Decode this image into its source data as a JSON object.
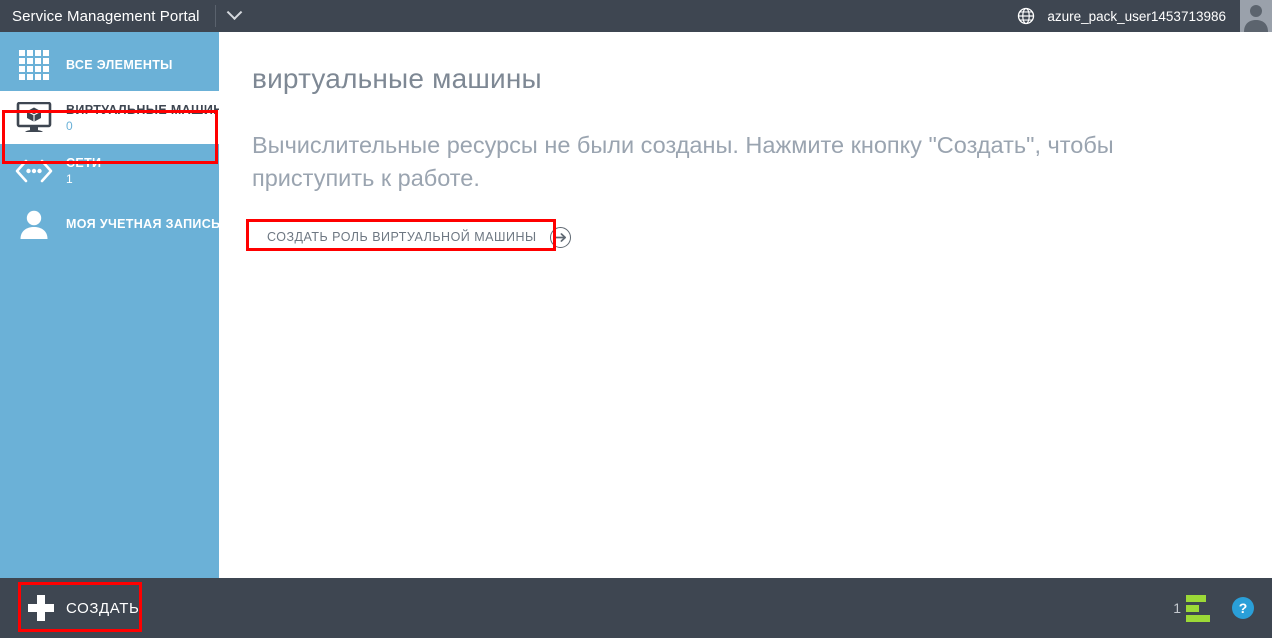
{
  "topbar": {
    "brand": "Service Management Portal",
    "chevron_icon": "chevron-down-icon",
    "globe_icon": "globe-icon",
    "user_name": "azure_pack_user1453713986",
    "avatar_icon": "user-avatar-icon"
  },
  "sidebar": {
    "items": [
      {
        "label": "ВСЕ ЭЛЕМЕНТЫ",
        "count": "",
        "icon": "grid-icon",
        "selected": false
      },
      {
        "label": "ВИРТУАЛЬНЫЕ МАШИНЫ",
        "count": "0",
        "icon": "virtual-machine-icon",
        "selected": true
      },
      {
        "label": "СЕТИ",
        "count": "1",
        "icon": "networks-icon",
        "selected": false
      },
      {
        "label": "МОЯ УЧЕТНАЯ ЗАПИСЬ",
        "count": "",
        "icon": "user-account-icon",
        "selected": false
      }
    ]
  },
  "main": {
    "page_title": "виртуальные машины",
    "empty_message": "Вычислительные ресурсы не были созданы. Нажмите кнопку \"Создать\", чтобы приступить к работе.",
    "create_link_label": "СОЗДАТЬ РОЛЬ ВИРТУАЛЬНОЙ МАШИНЫ",
    "create_link_icon": "arrow-right-circle-icon"
  },
  "bottombar": {
    "new_label": "СОЗДАТЬ",
    "new_icon": "plus-icon",
    "status_count": "1",
    "status_icon": "activity-bars-icon",
    "help_label": "?",
    "help_icon": "help-icon"
  },
  "colors": {
    "topbar": "#3e4651",
    "sidebar": "#6bb1d7",
    "accent_green": "#9cd937",
    "accent_blue": "#2a9fd8",
    "annotation": "#ff0000",
    "text_muted": "#9aa4b0"
  }
}
